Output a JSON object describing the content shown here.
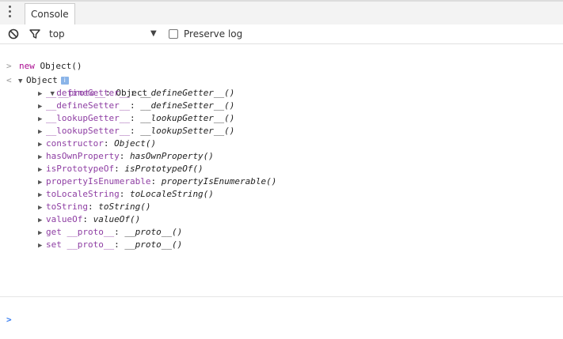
{
  "tabbar": {
    "console_tab": "Console"
  },
  "toolbar": {
    "context": "top",
    "preserve_log": "Preserve log",
    "preserve_log_checked": false
  },
  "console": {
    "input_command_keyword": "new",
    "input_command_rest": " Object()",
    "result_label": "Object",
    "proto_label": "__proto__",
    "proto_value": "Object",
    "proto_members": [
      {
        "name": "__defineGetter__",
        "value": "__defineGetter__()"
      },
      {
        "name": "__defineSetter__",
        "value": "__defineSetter__()"
      },
      {
        "name": "__lookupGetter__",
        "value": "__lookupGetter__()"
      },
      {
        "name": "__lookupSetter__",
        "value": "__lookupSetter__()"
      },
      {
        "name": "constructor",
        "value": "Object()"
      },
      {
        "name": "hasOwnProperty",
        "value": "hasOwnProperty()"
      },
      {
        "name": "isPrototypeOf",
        "value": "isPrototypeOf()"
      },
      {
        "name": "propertyIsEnumerable",
        "value": "propertyIsEnumerable()"
      },
      {
        "name": "toLocaleString",
        "value": "toLocaleString()"
      },
      {
        "name": "toString",
        "value": "toString()"
      },
      {
        "name": "valueOf",
        "value": "valueOf()"
      },
      {
        "name": "get __proto__",
        "value": "__proto__()"
      },
      {
        "name": "set __proto__",
        "value": "__proto__()"
      }
    ]
  }
}
